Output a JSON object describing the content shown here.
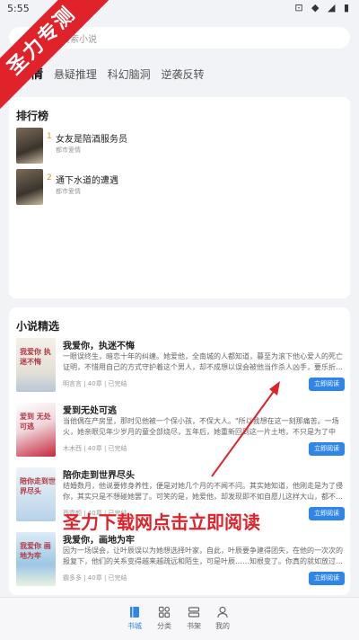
{
  "status": {
    "time": "5:55",
    "icons": "⊡ ◆ ◢ ▮"
  },
  "search": {
    "placeholder": "搜索小说"
  },
  "tabs": [
    {
      "label": "剧情"
    },
    {
      "label": "悬疑推理"
    },
    {
      "label": "科幻脑洞"
    },
    {
      "label": "逆袭反转"
    }
  ],
  "ranking": {
    "title": "排行榜",
    "items": [
      {
        "rank": "1",
        "title": "女友是陪酒服务员",
        "author": "都市爱情"
      },
      {
        "rank": "2",
        "title": "通下水道的遭遇",
        "author": "都市爱情"
      }
    ]
  },
  "picks": {
    "title": "小说精选",
    "items": [
      {
        "title": "我爱你，执迷不悔",
        "desc": "一眼误终生，暗恋十年的纠缠。她爱他，全南城的人都知道，暮至为滚下他心爱人的死亡证明，不惜用自己的方式守护着这个男人，却不成想以误会被他当作杀人凶手，要乐折…",
        "meta": "明言言 | 40章 | 已完结",
        "button": "立即阅读",
        "cover_text": "我爱你 执迷不悔"
      },
      {
        "title": "爱到无处可逃",
        "desc": "当他偶在产房里，那时见他被一个保小孩，不保大人。\"所以我想在这一刻那痛苦。一场火，她亲眼见年少岁月的童全部烧尽，五年后，她重新回到这一片土地，不只是为了中回…",
        "meta": "木木西 | 40章 | 已完结",
        "button": "立即阅读",
        "cover_text": "爱到 无处可逃"
      },
      {
        "title": "陪你走到世界尽头",
        "desc": "结婚数月，他说要修身养性，便是对她几个月的不闻不问。其实她知道，他刚走是为了侵你，其实只是不想碰她罢了。可笑的是，她爱他，却发现即不如自愿儿这样大山，都不…",
        "meta": "西霞颜 | 40章 | 已完结",
        "button": "立即阅读",
        "cover_text": "陪你走到世界尽头"
      },
      {
        "title": "我爱你，画地为牢",
        "desc": "因为一场误会，让叶辰误以为她想选择叶家，自此，叶辰要争建得团失，在他的一次次的报复下，他们的关系变得越来越疏远和陌生，可是叶辰……知根变了。你真的就如放过…",
        "meta": "霸多多 | 40章 | 已完结",
        "button": "立即阅读",
        "cover_text": "我爱你 画地为牢"
      }
    ]
  },
  "bottom_nav": [
    {
      "label": "书城",
      "icon": "book-icon"
    },
    {
      "label": "分类",
      "icon": "category-icon"
    },
    {
      "label": "书架",
      "icon": "shelf-icon"
    },
    {
      "label": "我的",
      "icon": "user-icon"
    }
  ],
  "watermark": {
    "ribbon": "圣力专测",
    "overlay": "圣力下载网点击立即阅读"
  },
  "colors": {
    "accent": "#2f86e8",
    "watermark": "#e0222b",
    "rank": "#e08a2a"
  }
}
